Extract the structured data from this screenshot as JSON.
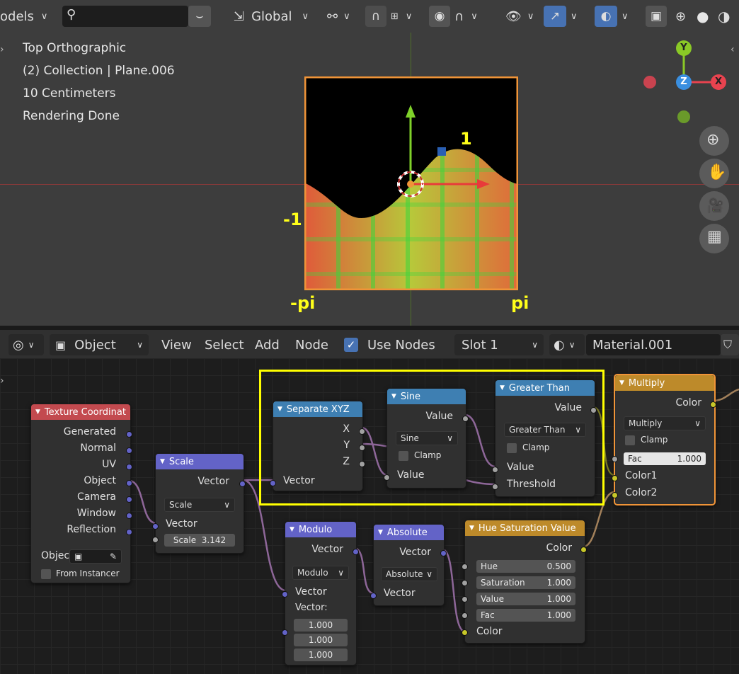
{
  "viewport": {
    "toolbar": {
      "mode_label": "odels",
      "orientation": "Global"
    },
    "overlay": [
      "Top Orthographic",
      "(2) Collection | Plane.006",
      "10 Centimeters",
      "Rendering Done"
    ],
    "plot_labels": {
      "top": "1",
      "left": "-1",
      "bottom_left": "-pi",
      "bottom_right": "pi"
    },
    "gizmo": {
      "y": "Y",
      "z": "Z",
      "x": "X"
    }
  },
  "node_header": {
    "object_mode": "Object",
    "menus": [
      "View",
      "Select",
      "Add",
      "Node"
    ],
    "use_nodes_label": "Use Nodes",
    "slot": "Slot 1",
    "material": "Material.001"
  },
  "nodes": {
    "texcoord": {
      "title": "Texture Coordinat",
      "outputs": [
        "Generated",
        "Normal",
        "UV",
        "Object",
        "Camera",
        "Window",
        "Reflection"
      ],
      "object_label": "Object",
      "from_instancer": "From Instancer"
    },
    "scale": {
      "title": "Scale",
      "out": "Vector",
      "mode": "Scale",
      "in": "Vector",
      "scale_label": "Scale",
      "scale_value": "3.142"
    },
    "sepxyz": {
      "title": "Separate XYZ",
      "outs": [
        "X",
        "Y",
        "Z"
      ],
      "in": "Vector"
    },
    "sine": {
      "title": "Sine",
      "out": "Value",
      "mode": "Sine",
      "clamp": "Clamp",
      "in": "Value"
    },
    "greater": {
      "title": "Greater Than",
      "out": "Value",
      "mode": "Greater Than",
      "clamp": "Clamp",
      "in1": "Value",
      "in2": "Threshold"
    },
    "multiply": {
      "title": "Multiply",
      "out": "Color",
      "mode": "Multiply",
      "clamp": "Clamp",
      "fac_label": "Fac",
      "fac_value": "1.000",
      "in1": "Color1",
      "in2": "Color2"
    },
    "modulo": {
      "title": "Modulo",
      "out": "Vector",
      "mode": "Modulo",
      "in": "Vector",
      "vec_label": "Vector:",
      "vals": [
        "1.000",
        "1.000",
        "1.000"
      ]
    },
    "absolute": {
      "title": "Absolute",
      "out": "Vector",
      "mode": "Absolute",
      "in": "Vector"
    },
    "hsv": {
      "title": "Hue Saturation Value",
      "out": "Color",
      "fields": [
        {
          "label": "Hue",
          "value": "0.500"
        },
        {
          "label": "Saturation",
          "value": "1.000"
        },
        {
          "label": "Value",
          "value": "1.000"
        },
        {
          "label": "Fac",
          "value": "1.000"
        }
      ],
      "in": "Color"
    }
  },
  "colors": {
    "accent": "#4772b3",
    "highlight": "#ffff00",
    "selected": "#f09438"
  }
}
